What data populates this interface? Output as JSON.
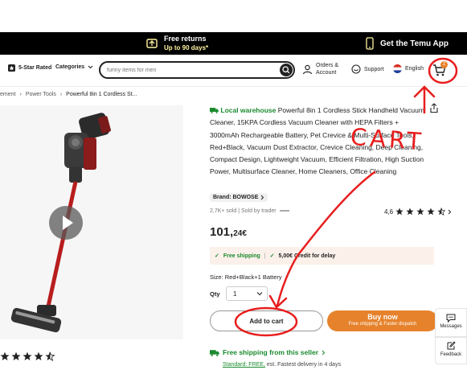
{
  "banner": {
    "returns_line1": "Free returns",
    "returns_line2": "Up to 90 days*",
    "app": "Get the Temu App"
  },
  "header": {
    "star_rated": "5-Star Rated",
    "categories": "Categories",
    "search_placeholder": "funny items for men",
    "orders_line1": "Orders &",
    "orders_line2": "Account",
    "support": "Support",
    "language": "English",
    "cart_count": "2"
  },
  "breadcrumb": {
    "items": [
      "ement",
      "Power Tools",
      "Powerful 8in 1 Cordless St..."
    ]
  },
  "product": {
    "local_warehouse": "Local warehouse",
    "title": "Powerful 8in 1 Cordless Stick Handheld Vacuum Cleaner, 15KPA Cordless Vacuum Cleaner with HEPA Filters + 3000mAh Rechargeable Battery, Pet Crevice & Multi-Surface Tools, Red+Black, Vacuum Dust Extractor, Crevice Cleaning, Deep Cleaning, Compact Design, Lightweight Vacuum, Efficient Filtration, High Suction Power, Multisurface Cleaner, Home Cleaners, Office Cleaning",
    "brand": "Brand: BOWOSE",
    "sold": "2,7K+ sold  |  Sold by trader",
    "rating_value": "4,6",
    "price_main": "101,",
    "price_small": "24€",
    "free_shipping": "Free shipping",
    "credit": "5,00€ Credit for delay",
    "size": "Size: Red+Black+1 Battery",
    "qty_label": "Qty",
    "qty_value": "1",
    "add_to_cart": "Add to cart",
    "buy_now": "Buy now",
    "buy_now_sub": "Free shipping & Faster dispatch",
    "free_ship_seller": "Free shipping from this seller",
    "standard_prefix": "Standard: FREE,",
    "standard_rest": " est. Fastest delivery in 4 days"
  },
  "side": {
    "messages": "Messages",
    "feedback": "Feedback"
  },
  "annotations": {
    "cart_text": "CART"
  },
  "colors": {
    "accent_orange": "#e6822b",
    "green": "#1a8a2e",
    "annotation_red": "#e81d1d"
  }
}
